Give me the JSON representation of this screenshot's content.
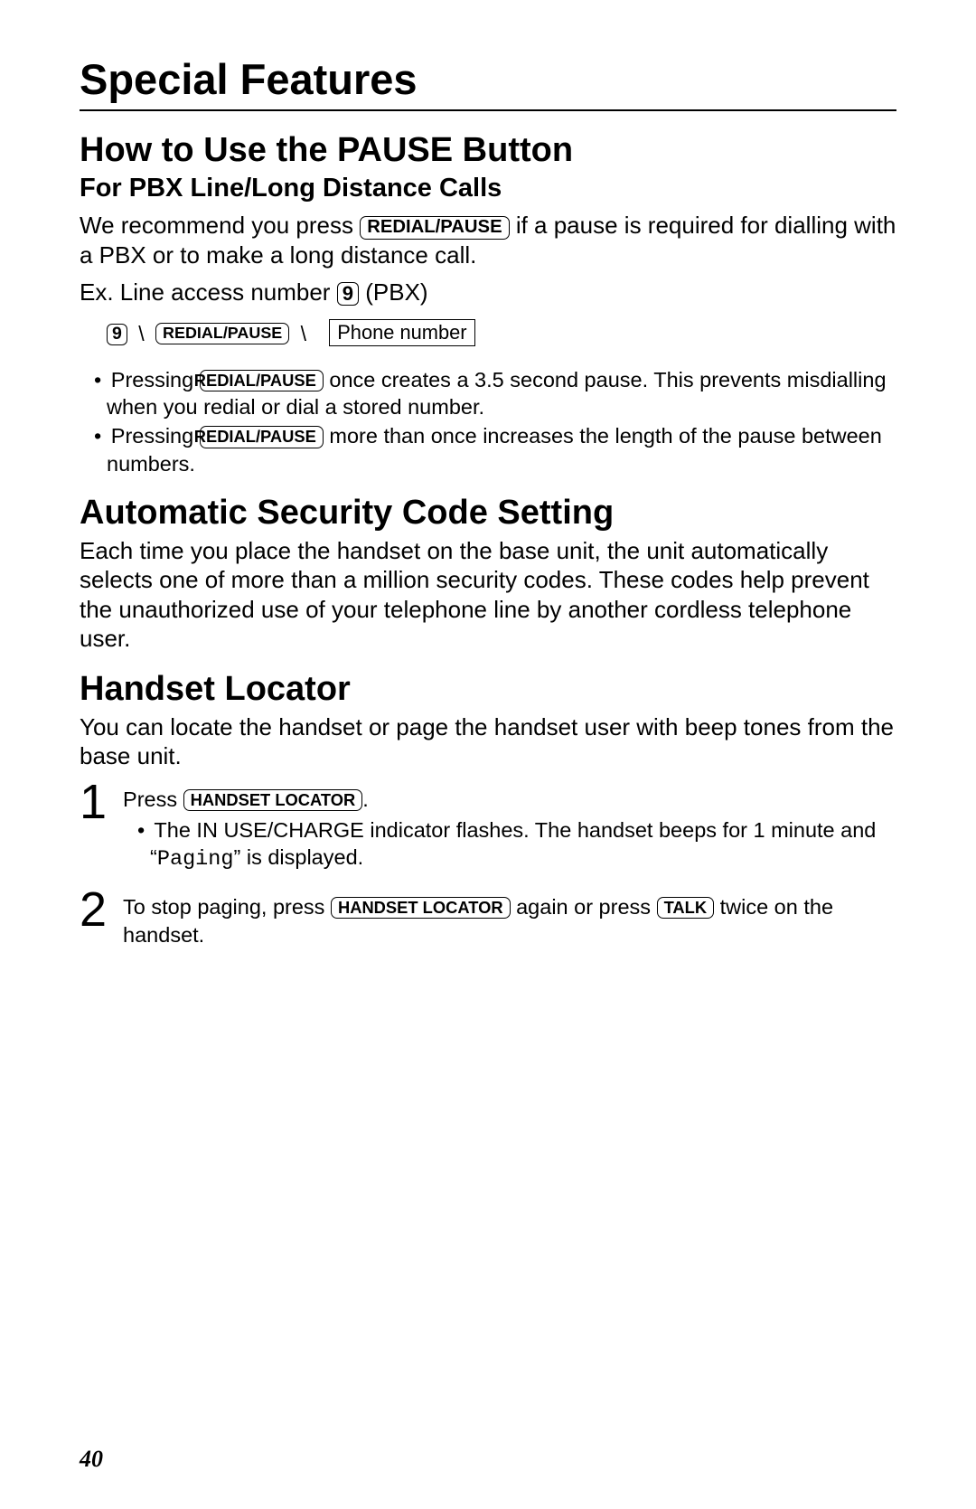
{
  "page": {
    "title": "Special Features",
    "number": "40"
  },
  "keys": {
    "redial_pause": "REDIAL/PAUSE",
    "nine": "9",
    "phone_number": "Phone number",
    "handset_locator": "HANDSET LOCATOR",
    "talk": "TALK"
  },
  "s1": {
    "heading": "How to Use the PAUSE Button",
    "subheading": "For PBX Line/Long Distance Calls",
    "p1_a": "We recommend you press ",
    "p1_b": " if a pause is required for dialling with a PBX or to make a long distance call.",
    "ex_a": "Ex.  Line access number ",
    "ex_b": " (PBX)",
    "arrow": "\\",
    "b1_a": "Pressing ",
    "b1_b": " once creates a 3.5 second pause. This prevents misdialling when you redial or dial a stored number.",
    "b2_a": "Pressing ",
    "b2_b": " more than once increases the length of the pause between numbers."
  },
  "s2": {
    "heading": "Automatic Security Code Setting",
    "p1": "Each time you place the handset on the base unit, the unit automatically selects one of more than a million security codes. These codes help prevent the unauthorized use of your telephone line by another cordless telephone user."
  },
  "s3": {
    "heading": "Handset Locator",
    "p1": "You can locate the handset or page the handset user with beep tones from the base unit.",
    "step1_num": "1",
    "step1_a": "Press ",
    "step1_b": ".",
    "step1_bullet_a": "The IN USE/CHARGE indicator flashes. The handset beeps for 1 minute and “",
    "step1_bullet_mono": "Paging",
    "step1_bullet_b": "” is displayed.",
    "step2_num": "2",
    "step2_a": "To stop paging, press ",
    "step2_b": " again or press ",
    "step2_c": " twice on the handset."
  }
}
